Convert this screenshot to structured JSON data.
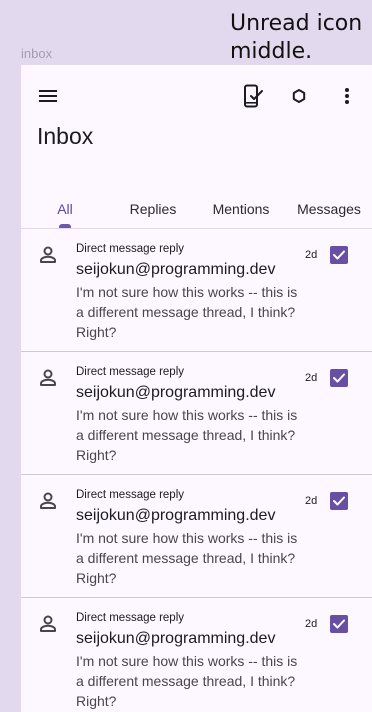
{
  "annotation": "Unread icon\nmiddle.",
  "caption": "inbox",
  "toolbar": {
    "menu_icon": "hamburger-menu-icon",
    "phone_icon": "phone-check-icon",
    "hex_icon": "hexagon-icon",
    "more_icon": "more-vertical-icon"
  },
  "page": {
    "title": "Inbox"
  },
  "tabs": [
    {
      "label": "All",
      "active": true
    },
    {
      "label": "Replies",
      "active": false
    },
    {
      "label": "Mentions",
      "active": false
    },
    {
      "label": "Messages",
      "active": false
    }
  ],
  "items": [
    {
      "kind": "Direct message reply",
      "sender": "seijokun@programming.dev",
      "body": "I'm not sure how this works -- this is a different message thread, I think? Right?",
      "age": "2d",
      "read": true
    },
    {
      "kind": "Direct message reply",
      "sender": "seijokun@programming.dev",
      "body": "I'm not sure how this works -- this is a different message thread, I think? Right?",
      "age": "2d",
      "read": true
    },
    {
      "kind": "Direct message reply",
      "sender": "seijokun@programming.dev",
      "body": "I'm not sure how this works -- this is a different message thread, I think? Right?",
      "age": "2d",
      "read": true
    },
    {
      "kind": "Direct message reply",
      "sender": "seijokun@programming.dev",
      "body": "I'm not sure how this works -- this is a different message thread, I think? Right?",
      "age": "2d",
      "read": true
    }
  ],
  "colors": {
    "accent": "#6750a4",
    "background": "#fdf7ff",
    "frame": "#e3d9ee"
  }
}
